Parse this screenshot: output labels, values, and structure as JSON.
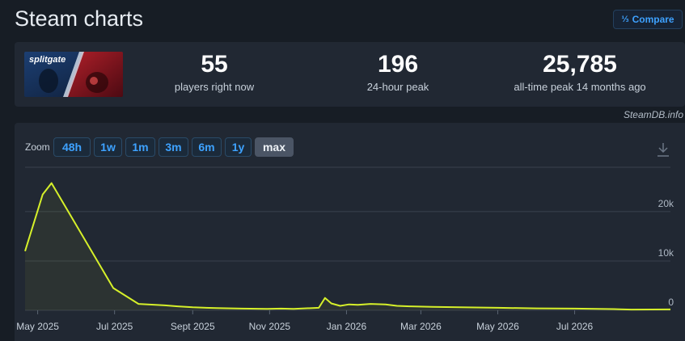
{
  "header": {
    "title": "Steam charts",
    "compare_label": "Compare"
  },
  "stats": [
    {
      "value": "55",
      "label": "players right now"
    },
    {
      "value": "196",
      "label": "24-hour peak"
    },
    {
      "value": "25,785",
      "label": "all-time peak 14 months ago"
    }
  ],
  "game": {
    "logo_text": "splitgate"
  },
  "watermark": "SteamDB.info",
  "zoom": {
    "label": "Zoom",
    "options": [
      "48h",
      "1w",
      "1m",
      "3m",
      "6m",
      "1y",
      "max"
    ],
    "active": "max"
  },
  "colors": {
    "line": "#d6f02a",
    "accent": "#3ea2ff",
    "grid": "#39414e",
    "background": "#171d25"
  },
  "chart_data": {
    "type": "line",
    "grid": true,
    "x_type": "date",
    "xlim": [
      "2025-04-21",
      "2026-09-15"
    ],
    "ylim": [
      0,
      29000
    ],
    "y_ticks": [
      0,
      10000,
      20000
    ],
    "y_tick_labels": [
      "0",
      "10k",
      "20k"
    ],
    "y_axis_side": "right",
    "x_ticks": [
      "2025-05-01",
      "2025-07-01",
      "2025-09-01",
      "2025-11-01",
      "2026-01-01",
      "2026-03-01",
      "2026-05-01",
      "2026-07-01"
    ],
    "x_tick_labels": [
      "May 2025",
      "Jul 2025",
      "Sept 2025",
      "Nov 2025",
      "Jan 2026",
      "Mar 2026",
      "May 2026",
      "Jul 2026"
    ],
    "series": [
      {
        "x": [
          "2025-04-21",
          "2025-05-05",
          "2025-05-12",
          "2025-06-30",
          "2025-07-20",
          "2025-08-10",
          "2025-08-20",
          "2025-09-01",
          "2025-09-20",
          "2025-10-10",
          "2025-10-30",
          "2025-11-10",
          "2025-11-20",
          "2025-12-10",
          "2025-12-15",
          "2025-12-20",
          "2025-12-27",
          "2026-01-03",
          "2026-01-10",
          "2026-01-20",
          "2026-02-01",
          "2026-02-10",
          "2026-02-20",
          "2026-03-10",
          "2026-04-01",
          "2026-05-01",
          "2026-06-01",
          "2026-07-01",
          "2026-08-01",
          "2026-08-15",
          "2026-09-15"
        ],
        "y": [
          12000,
          23500,
          25785,
          4500,
          1300,
          1000,
          800,
          600,
          450,
          350,
          300,
          350,
          300,
          500,
          2500,
          1400,
          900,
          1200,
          1100,
          1300,
          1200,
          900,
          800,
          700,
          600,
          500,
          400,
          350,
          250,
          150,
          180
        ]
      }
    ]
  }
}
